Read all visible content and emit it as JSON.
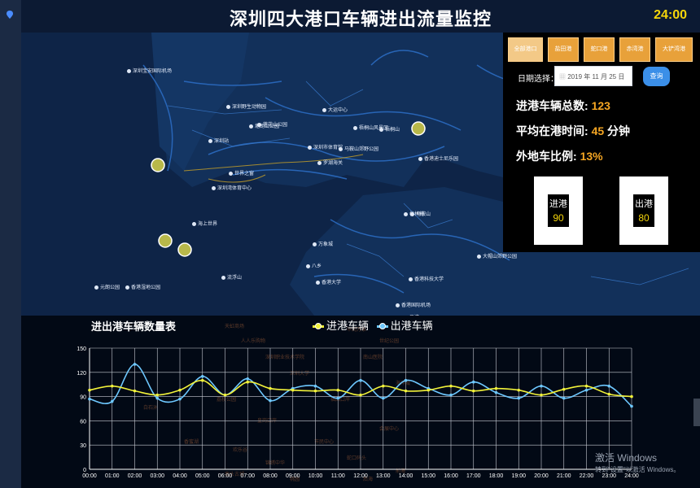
{
  "page": {
    "title": "深圳四大港口车辆进出流量监控",
    "clock": "24:00"
  },
  "map": {
    "labels": [
      "深圳宝安国际机场",
      "深圳野生动物园",
      "塘朗山公园",
      "梧桐山",
      "莲花山公园",
      "深圳市体育馆",
      "深圳站",
      "罗湖海关",
      "世界之窗",
      "深圳湾体育中心",
      "海上世界",
      "梅林村",
      "马鞍山",
      "香港大学",
      "八乡",
      "流浮山",
      "香港科技大学",
      "梧桐山风景区",
      "南湾",
      "大鹏",
      "香港湿地公园",
      "香港迪士尼乐园",
      "西部通道",
      "大运中心",
      "万象城",
      "香港国际机场",
      "元朗公园",
      "大帽山郊野公园",
      "马鞍山郊野公园",
      "马湾",
      "东平洲"
    ]
  },
  "controls": {
    "ports": [
      "全部港口",
      "盐田港",
      "蛇口港",
      "赤湾港",
      "大铲湾港"
    ],
    "active_port": "全部港口",
    "date_label": "日期选择：",
    "date_value": "2019 年 11 月 25 日",
    "query_label": "查询"
  },
  "stats": {
    "total_label": "进港车辆总数:",
    "total_value": "123",
    "avg_label": "平均在港时间:",
    "avg_value": "45",
    "avg_unit": "分钟",
    "ratio_label": "外地车比例:",
    "ratio_value": "13%"
  },
  "boxes": {
    "in_label": "进港",
    "in_value": "90",
    "out_label": "出港",
    "out_value": "80"
  },
  "chart_data": {
    "type": "line",
    "title": "进出港车辆数量表",
    "xlabel": "",
    "ylabel": "",
    "ylim": [
      0,
      150
    ],
    "yticks": [
      0,
      30,
      60,
      90,
      120,
      150
    ],
    "grid": true,
    "legend_position": "top",
    "x": [
      "00:00",
      "01:00",
      "02:00",
      "03:00",
      "04:00",
      "05:00",
      "06:00",
      "07:00",
      "08:00",
      "09:00",
      "10:00",
      "11:00",
      "12:00",
      "13:00",
      "14:00",
      "15:00",
      "16:00",
      "17:00",
      "18:00",
      "19:00",
      "20:00",
      "21:00",
      "22:00",
      "23:00",
      "24:00"
    ],
    "series": [
      {
        "name": "进港车辆",
        "color": "#f2f23a",
        "values": [
          98,
          103,
          97,
          92,
          98,
          110,
          92,
          108,
          100,
          98,
          97,
          98,
          92,
          103,
          97,
          98,
          103,
          97,
          100,
          98,
          92,
          99,
          103,
          93,
          90
        ]
      },
      {
        "name": "出港车辆",
        "color": "#6ec8ff",
        "values": [
          87,
          84,
          130,
          88,
          87,
          115,
          92,
          112,
          85,
          100,
          103,
          88,
          110,
          88,
          110,
          100,
          92,
          108,
          95,
          88,
          103,
          88,
          98,
          103,
          78
        ]
      }
    ]
  },
  "background_labels": [
    "天虹商场",
    "人人乐购物",
    "华润万家",
    "世纪公园",
    "深圳职业技术学院",
    "南山医院",
    "深圳大学",
    "海岸城",
    "荔枝公园",
    "福田口岸",
    "皇岗口岸",
    "会展中心",
    "市民中心",
    "欢乐谷",
    "锦绣中华",
    "蛇口码头",
    "南头古城",
    "前海",
    "桃园",
    "后海",
    "白石洲",
    "香蜜湖"
  ],
  "system": {
    "watermark_title": "激活 Windows",
    "watermark_sub": "转到\"设置\"以激活 Windows。"
  }
}
